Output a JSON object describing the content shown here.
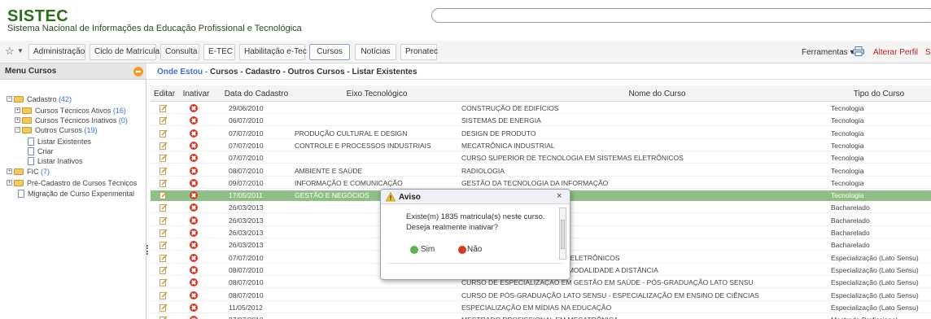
{
  "header": {
    "logo": "SISTEC",
    "subtitle": "Sistema Nacional de Informações da Educação Profissional e Tecnológica",
    "search_placeholder": ""
  },
  "nav": {
    "tabs": [
      "Administração",
      "Ciclo de Matrícula",
      "Consulta",
      "E-TEC",
      "Habilitação e-Tec",
      "Cursos",
      "Notícias",
      "Pronatec"
    ],
    "active_tab": "Cursos",
    "tools_label": "Ferramentas",
    "profile_label": "Alterar Perfil",
    "logout_label": "Sa"
  },
  "sidebar": {
    "title": "Menu Cursos",
    "tree": [
      {
        "label": "Cadastro",
        "count": "(42)"
      },
      {
        "label": "Cursos Técnicos Ativos",
        "count": "(16)"
      },
      {
        "label": "Cursos Técnicos Inativos",
        "count": "(0)"
      },
      {
        "label": "Outros Cursos",
        "count": "(19)"
      },
      {
        "label": "Listar Existentes",
        "count": ""
      },
      {
        "label": "Criar",
        "count": ""
      },
      {
        "label": "Listar Inativos",
        "count": ""
      },
      {
        "label": "FIC",
        "count": "(7)"
      },
      {
        "label": "Pré-Cadastro de Cursos Técnicos",
        "count": ""
      },
      {
        "label": "Migração de Curso Experimental",
        "count": ""
      }
    ]
  },
  "breadcrumb": {
    "label": "Onde Estou -",
    "path": "Cursos  - Cadastro - Outros Cursos - Listar Existentes"
  },
  "table": {
    "columns": [
      "Editar",
      "Inativar",
      "Data do Cadastro",
      "Eixo Tecnológico",
      "Nome do Curso",
      "Tipo do Curso"
    ],
    "rows": [
      {
        "date": "29/06/2010",
        "eixo": "",
        "nome": "CONSTRUÇÃO DE EDIFÍCIOS",
        "tipo": "Tecnologia"
      },
      {
        "date": "06/07/2010",
        "eixo": "",
        "nome": "SISTEMAS DE ENERGIA",
        "tipo": "Tecnologia"
      },
      {
        "date": "07/07/2010",
        "eixo": "PRODUÇÃO CULTURAL E DESIGN",
        "nome": "DESIGN DE PRODUTO",
        "tipo": "Tecnologia"
      },
      {
        "date": "07/07/2010",
        "eixo": "CONTROLE E PROCESSOS INDUSTRIAIS",
        "nome": "MECATRÔNICA INDUSTRIAL",
        "tipo": "Tecnologia"
      },
      {
        "date": "07/07/2010",
        "eixo": "",
        "nome": "CURSO SUPERIOR DE TECNOLOGIA EM SISTEMAS ELETRÔNICOS",
        "tipo": "Tecnologia"
      },
      {
        "date": "08/07/2010",
        "eixo": "AMBIENTE E SAÚDE",
        "nome": "RADIOLOGIA",
        "tipo": "Tecnologia"
      },
      {
        "date": "09/07/2010",
        "eixo": "INFORMAÇÃO E COMUNICAÇÃO",
        "nome": "GESTÃO DA TECNOLOGIA DA INFORMAÇÃO",
        "tipo": "Tecnologia"
      },
      {
        "date": "17/05/2011",
        "eixo": "GESTÃO E NEGÓCIOS",
        "nome": "",
        "tipo": "Tecnologia",
        "selected": true
      },
      {
        "date": "26/03/2013",
        "eixo": "",
        "nome": "",
        "tipo": "Bacharelado"
      },
      {
        "date": "26/03/2013",
        "eixo": "",
        "nome": "",
        "tipo": "Bacharelado"
      },
      {
        "date": "26/03/2013",
        "eixo": "",
        "nome": "",
        "tipo": "Bacharelado"
      },
      {
        "date": "26/03/2013",
        "eixo": "",
        "nome": "",
        "tipo": "Bacharelado"
      },
      {
        "date": "07/07/2010",
        "eixo": "",
        "nome": "ENVOLVIMENTO DE PRODUTOS ELETRÔNICOS",
        "tipo": "Especialização (Lato Sensu)"
      },
      {
        "date": "08/07/2010",
        "eixo": "",
        "nome": "ENSU EM GESTÃO PÚBLICA NA MODALIDADE A DISTÂNCIA",
        "tipo": "Especialização (Lato Sensu)"
      },
      {
        "date": "08/07/2010",
        "eixo": "",
        "nome": "CURSO DE ESPECIALIZAÇÃO EM GESTÃO EM SAÚDE - PÓS-GRADUAÇÃO LATO SENSU",
        "tipo": "Especialização (Lato Sensu)"
      },
      {
        "date": "08/07/2010",
        "eixo": "",
        "nome": "CURSO DE PÓS-GRADUAÇÃO LATO SENSU - ESPECIALIZAÇÃO EM ENSINO DE CIÊNCIAS",
        "tipo": "Especialização (Lato Sensu)"
      },
      {
        "date": "11/05/2012",
        "eixo": "",
        "nome": "ESPECIALIZAÇÃO EM MÍDIAS NA EDUCAÇÃO",
        "tipo": "Especialização (Lato Sensu)"
      },
      {
        "date": "07/07/2010",
        "eixo": "",
        "nome": "MESTRADO PROFISSIONAL EM MECATRÔNICA",
        "tipo": "Mestrado Profissional"
      }
    ]
  },
  "dialog": {
    "title": "Aviso",
    "close": "×",
    "message": "Existe(m) 1835 matricula(s) neste curso. Deseja realmente inativar?",
    "yes_label": "Sim",
    "no_label": "Não"
  },
  "colors": {
    "brand": "#2a6e1c",
    "link": "#3d6fd1",
    "danger": "#d33a25",
    "selected_row": "#8fbf86"
  }
}
